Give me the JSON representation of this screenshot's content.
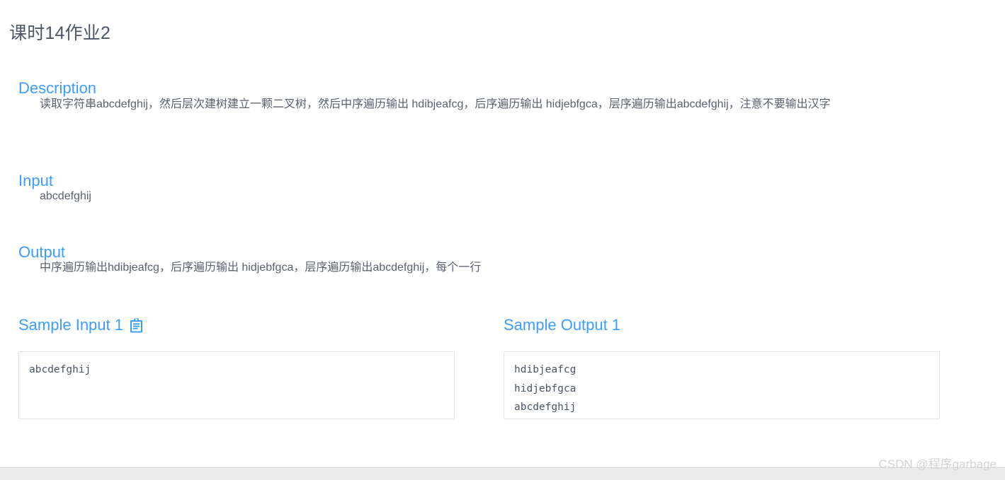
{
  "page": {
    "title": "课时14作业2"
  },
  "sections": {
    "description": {
      "heading": "Description",
      "body": "读取字符串abcdefghij，然后层次建树建立一颗二叉树，然后中序遍历输出 hdibjeafcg，后序遍历输出 hidjebfgca，层序遍历输出abcdefghij，注意不要输出汉字"
    },
    "input": {
      "heading": "Input",
      "body": "abcdefghij"
    },
    "output": {
      "heading": "Output",
      "body": "中序遍历输出hdibjeafcg，后序遍历输出 hidjebfgca，层序遍历输出abcdefghij，每个一行"
    }
  },
  "samples": {
    "input": {
      "heading": "Sample Input 1",
      "copy_icon": "clipboard-copy-icon",
      "code": "abcdefghij"
    },
    "output": {
      "heading": "Sample Output 1",
      "code": "hdibjeafcg\nhidjebfgca\nabcdefghij"
    }
  },
  "footer": {
    "watermark": "CSDN @程序garbage"
  },
  "colors": {
    "heading_blue": "#3c9cff",
    "title_text": "#4c5667",
    "body_text": "#59616e",
    "code_text": "#4a5466",
    "box_border": "#e4e4e4",
    "watermark": "#d3d3d3",
    "footer_strip": "#ebebeb"
  }
}
